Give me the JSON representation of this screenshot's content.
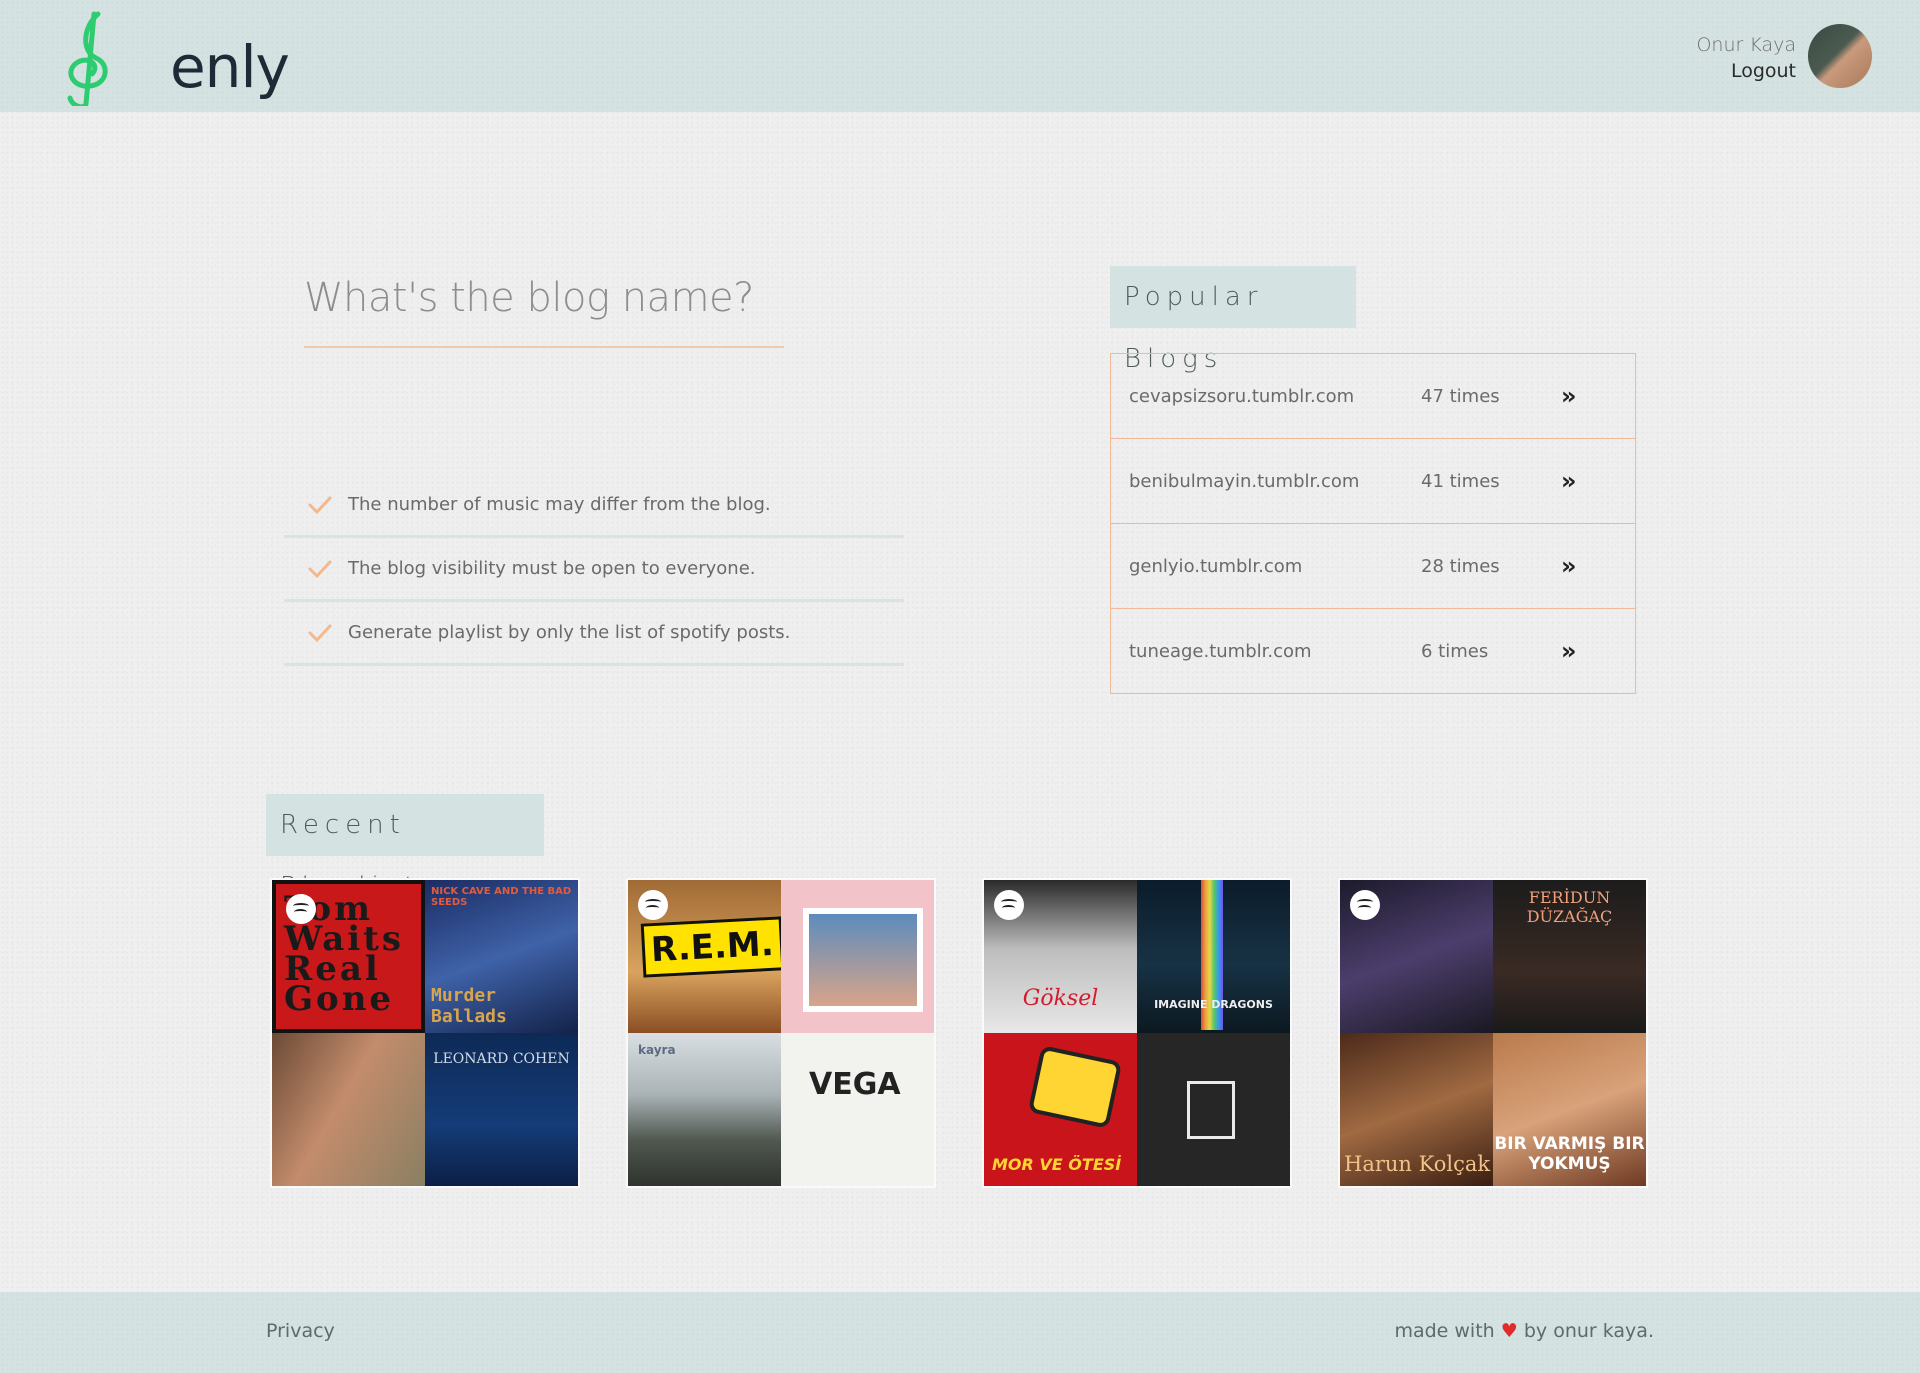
{
  "header": {
    "brand": "enly",
    "user_name": "Onur Kaya",
    "logout_label": "Logout"
  },
  "search": {
    "placeholder": "What's the blog name?"
  },
  "notes": [
    "The number of music may differ from the blog.",
    "The blog visibility must be open to everyone.",
    "Generate playlist by only the list of spotify posts."
  ],
  "popular": {
    "title": "Popular Blogs",
    "blogs": [
      {
        "name": "cevapsizsoru.tumblr.com",
        "count": "47 times",
        "arrow": "»"
      },
      {
        "name": "benibulmayin.tumblr.com",
        "count": "41 times",
        "arrow": "»"
      },
      {
        "name": "genlyio.tumblr.com",
        "count": "28 times",
        "arrow": "»"
      },
      {
        "name": "tuneage.tumblr.com",
        "count": "6 times",
        "arrow": "»"
      }
    ]
  },
  "recent": {
    "title": "Recent Playlists",
    "covers": {
      "p1_tom": "Tom Waits Real Gone",
      "p1_nick_top": "NICK CAVE AND THE BAD SEEDS",
      "p1_nick": "Murder Ballads",
      "p1_leonard": "LEONARD COHEN",
      "p2_rem": "R.E.M.",
      "p2_kayra": "kayra",
      "p2_vega": "VEGA",
      "p3_sen": "Göksel",
      "p3_dragons": "IMAGINE DRAGONS",
      "p3_radio": "MOR VE ÖTESİ",
      "p4_feridun": "FERİDUN DÜZAĞAÇ",
      "p4_harun": "Harun Kolçak",
      "p4_birvarmis": "BIR VARMIŞ BIR YOKMUŞ"
    }
  },
  "footer": {
    "privacy_label": "Privacy",
    "credits_prefix": "made with",
    "heart": "♥",
    "credits_suffix": "by onur kaya."
  },
  "colors": {
    "header_bg": "#d5e2e2",
    "accent_orange": "#f1b99a",
    "heart_red": "#e12b2b"
  }
}
